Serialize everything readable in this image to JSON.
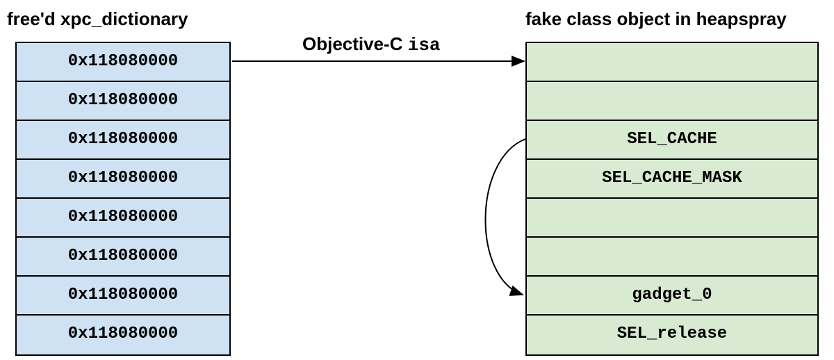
{
  "left": {
    "title": "free'd xpc_dictionary",
    "rows": [
      "0x118080000",
      "0x118080000",
      "0x118080000",
      "0x118080000",
      "0x118080000",
      "0x118080000",
      "0x118080000",
      "0x118080000"
    ]
  },
  "right": {
    "title": "fake class object in heapspray",
    "rows": [
      "",
      "",
      "SEL_CACHE",
      "SEL_CACHE_MASK",
      "",
      "",
      "gadget_0",
      "SEL_release"
    ]
  },
  "arrow": {
    "label_prefix": "Objective-C ",
    "label_mono": "isa"
  }
}
